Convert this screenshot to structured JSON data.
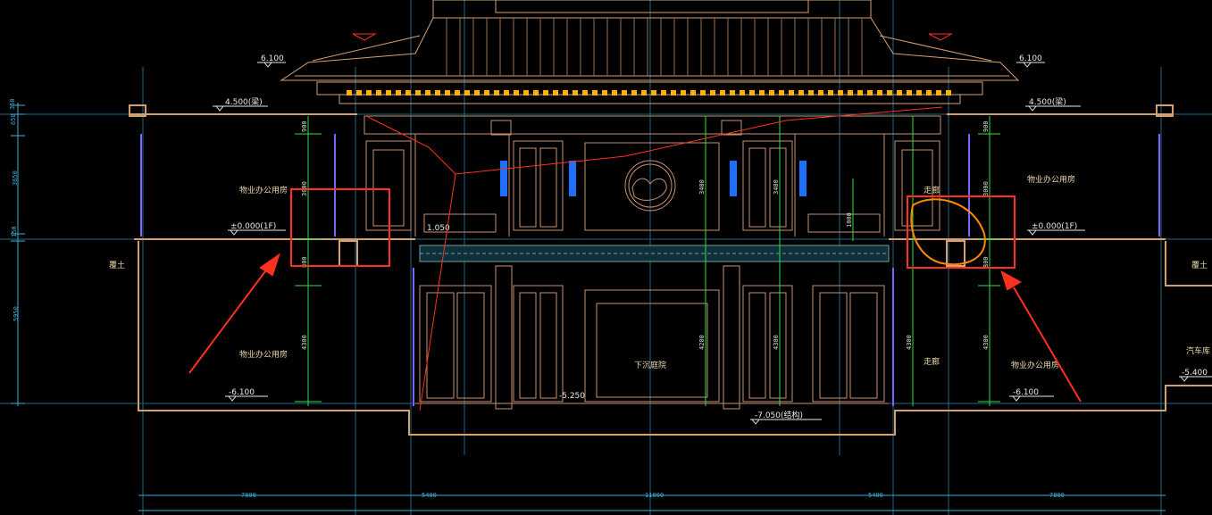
{
  "drawing": {
    "elevations": {
      "roof_left": "6.100",
      "roof_right": "6.100",
      "upper_left": "4.500(梁)",
      "upper_right": "4.500(梁)",
      "ground_left": "±0.000(1F)",
      "ground_right": "±0.000(1F)",
      "base_left": "-6.100",
      "base_right": "-6.100",
      "pit": "-7.050(结构)",
      "right_low": "-5.400",
      "inner_left": "-5.250",
      "mid_left": "1.050"
    },
    "rooms": {
      "upper_left": "物业办公用房",
      "upper_right": "物业办公用房",
      "lower_left": "物业办公用房",
      "lower_right": "物业办公用房",
      "center_lower": "下沉庭院",
      "left_soil": "覆土",
      "right_soil": "覆土",
      "corridor_upper": "走廊",
      "corridor_lower": "走廊",
      "car": "汽车库"
    },
    "left_dims": [
      "350",
      "650",
      "3650",
      "150",
      "5950"
    ],
    "bottom_dims": [
      "7800",
      "5400",
      "11000",
      "5400",
      "7800"
    ],
    "green_dims": {
      "a": "900",
      "b": "3000",
      "c": "800",
      "d": "4300",
      "e": "3400",
      "f": "3400",
      "g": "1000",
      "h": "4200",
      "i": "4300",
      "j": "900",
      "k": "3000",
      "l": "800",
      "m": "4300",
      "n": "4300"
    },
    "colors": {
      "background": "#000000",
      "wall": "#d4a070",
      "dimension": "#3bb0d8",
      "green": "#30e040",
      "annotation": "#ff3020",
      "accent_blue": "#2070ff",
      "purple": "#8060ff"
    }
  }
}
